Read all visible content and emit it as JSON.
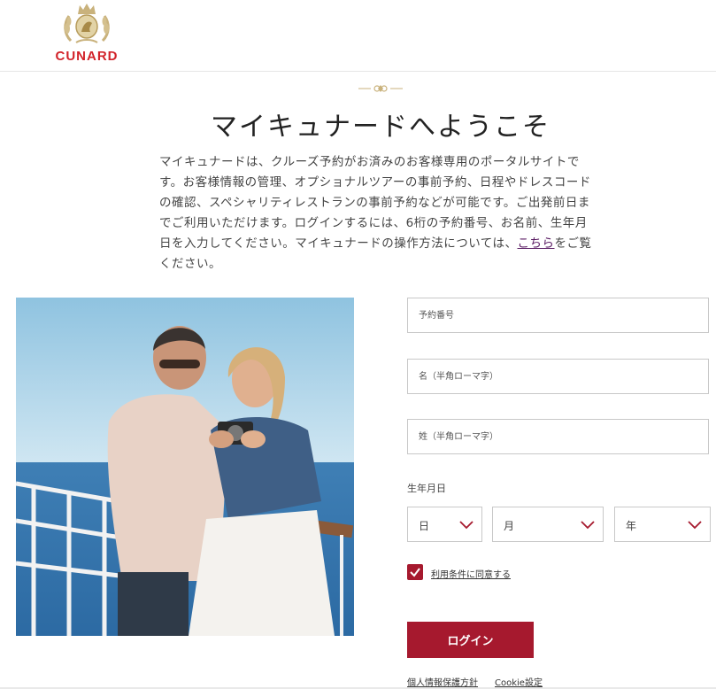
{
  "brand": {
    "name": "CUNARD",
    "color": "#d2232a"
  },
  "accent_color": "#a6192e",
  "page": {
    "title": "マイキュナードへようこそ",
    "intro_text": "マイキュナードは、クルーズ予約がお済みのお客様専用のポータルサイトです。お客様情報の管理、オプショナルツアーの事前予約、日程やドレスコードの確認、スペシャリティレストランの事前予約などが可能です。ご出発前日までご利用いただけます。ログインするには、6桁の予約番号、お名前、生年月日を入力してください。マイキュナードの操作方法については、",
    "intro_link": "こちら",
    "intro_suffix": "をご覧ください。"
  },
  "form": {
    "booking_number_placeholder": "予約番号",
    "first_name_placeholder": "名（半角ローマ字）",
    "last_name_placeholder": "姓（半角ローマ字）",
    "dob_label": "生年月日",
    "dob_day": "日",
    "dob_month": "月",
    "dob_year": "年",
    "terms_checked": true,
    "terms_label": "利用条件に同意する",
    "login_label": "ログイン"
  },
  "footer": {
    "privacy_label": "個人情報保護方針",
    "cookie_label": "Cookie設定"
  },
  "icons": {
    "crest": "cunard-crest-icon",
    "chevron": "chevron-down-icon",
    "check": "check-icon"
  }
}
